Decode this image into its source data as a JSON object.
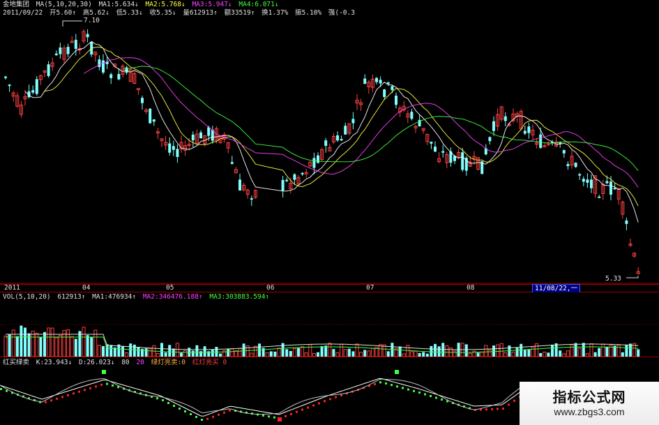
{
  "main": {
    "stock_name": "金地集团",
    "ma_label": "MA(5,10,20,30)",
    "ma1": "MA1:5.634↓",
    "ma2": "MA2:5.768↓",
    "ma3": "MA3:5.947↓",
    "ma4": "MA4:6.071↓",
    "date": "2011/09/22",
    "open": "开5.60↑",
    "high": "高5.62↓",
    "low": "低5.33↓",
    "close": "收5.35↓",
    "volume": "量612913↑",
    "amount": "额33519↑",
    "turnover": "换1.37%",
    "amplitude": "振5.10%",
    "strength": "强(-0.3",
    "high_label": "7.10",
    "low_label": "5.33"
  },
  "time_axis": {
    "labels": [
      "2011",
      "04",
      "05",
      "06",
      "07",
      "08"
    ],
    "cursor_date": "11/08/22,一"
  },
  "volume": {
    "label": "VOL(5,10,20)",
    "value": "612913↑",
    "ma1": "MA1:476934↑",
    "ma2": "MA2:346476.188↑",
    "ma3": "MA3:303883.594↑"
  },
  "kd": {
    "title": "红买绿卖",
    "k": "K:23.943↓",
    "d": "D:26.023↓",
    "level80": "80",
    "level20": "20",
    "green_signal": "绿灯亮卖:0",
    "red_signal": "红灯亮买 0"
  },
  "watermark": {
    "title": "指标公式网",
    "url": "www.zbgs3.com"
  },
  "chart_data": {
    "type": "candlestick",
    "price_range": [
      5.33,
      7.1
    ],
    "series": [
      {
        "name": "MA1",
        "color": "#ffffff"
      },
      {
        "name": "MA2",
        "color": "#ffff40"
      },
      {
        "name": "MA3",
        "color": "#ff40ff"
      },
      {
        "name": "MA4",
        "color": "#40ff40"
      }
    ],
    "colors": {
      "up": "#ff4040",
      "down": "#80ffff",
      "grid": "#a00000"
    }
  }
}
